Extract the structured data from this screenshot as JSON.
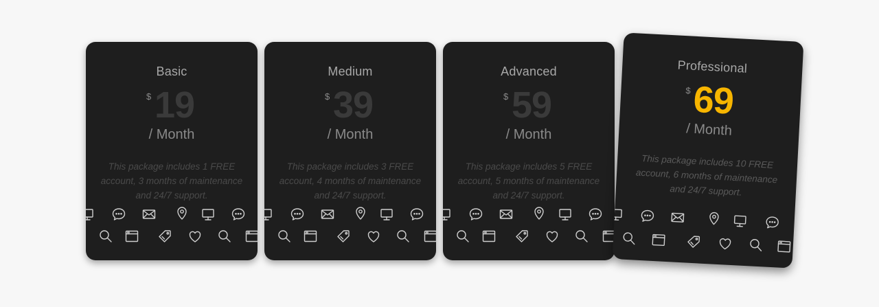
{
  "currency_symbol": "$",
  "plans": [
    {
      "name": "Basic",
      "price": "19",
      "period": "/ Month",
      "description": "This package includes 1 FREE account, 3 months of maintenance and 24/7 support."
    },
    {
      "name": "Medium",
      "price": "39",
      "period": "/ Month",
      "description": "This package includes 3 FREE account, 4 months of maintenance and 24/7 support."
    },
    {
      "name": "Advanced",
      "price": "59",
      "period": "/ Month",
      "description": "This package includes 5 FREE account, 5 months of maintenance and 24/7 support."
    },
    {
      "name": "Professional",
      "price": "69",
      "period": "/ Month",
      "description": "This package includes 10 FREE account, 6 months of maintenance and 24/7 support."
    }
  ],
  "colors": {
    "card_bg": "#1e1e1e",
    "highlight_price": "#f7b500",
    "page_bg": "#f7f7f7"
  },
  "icon_strip": [
    "monitor-icon",
    "chat-icon",
    "mail-icon",
    "location-pin-icon",
    "monitor-icon",
    "chat-icon",
    "search-icon",
    "browser-window-icon",
    "tag-icon",
    "heart-icon",
    "search-icon",
    "browser-window-icon"
  ]
}
